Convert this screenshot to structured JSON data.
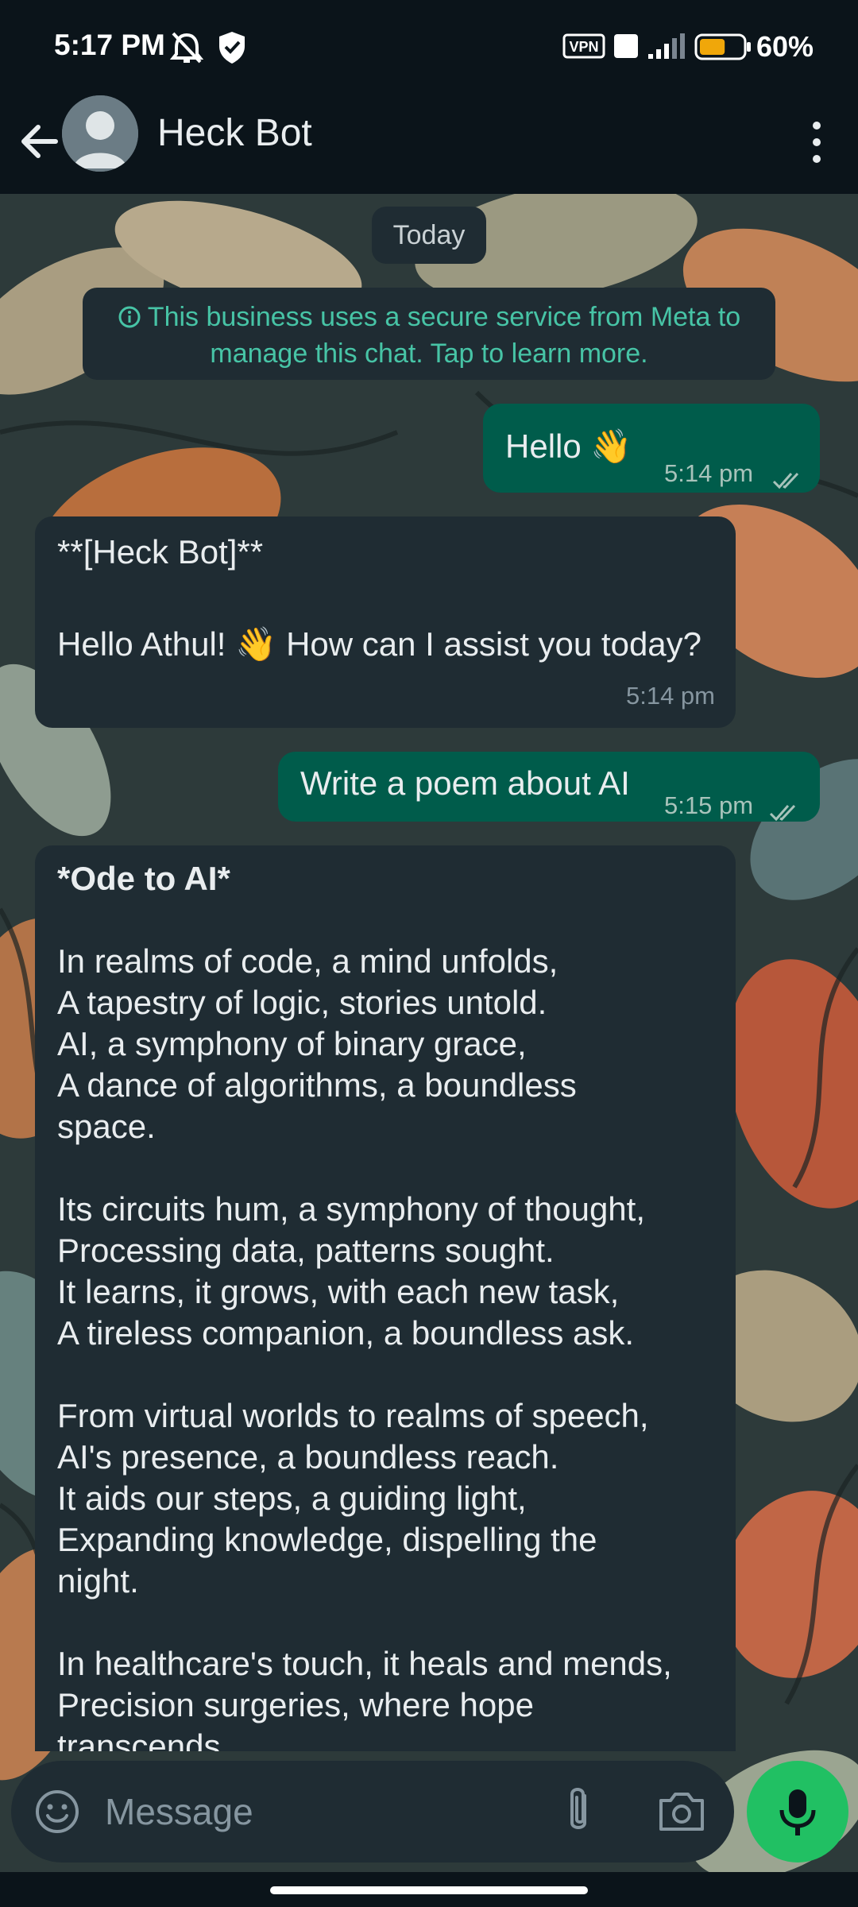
{
  "status_bar": {
    "time": "5:17 PM",
    "battery_percent": "60%",
    "battery_level": 0.6,
    "icons": [
      "alarm-off-icon",
      "shield-icon",
      "vpn-icon",
      "volte-icon",
      "signal-icon",
      "battery-icon"
    ],
    "vpn_label": "VPN"
  },
  "header": {
    "title": "Heck Bot",
    "icons": [
      "back-arrow-icon",
      "avatar",
      "more-vertical-icon"
    ]
  },
  "chat": {
    "date_chip": "Today",
    "notice": "This business uses a secure service from Meta to manage this chat. Tap to learn more.",
    "messages": [
      {
        "direction": "out",
        "text": "Hello 👋",
        "time": "5:14 pm",
        "status": "read"
      },
      {
        "direction": "in",
        "sender_line": "**[Heck Bot]**",
        "text": "Hello Athul! 👋 How can I assist you today?",
        "time": "5:14 pm"
      },
      {
        "direction": "out",
        "text": "Write a poem about AI",
        "time": "5:15 pm",
        "status": "read"
      },
      {
        "direction": "in",
        "title": "*Ode to AI*",
        "lines": [
          "In realms of code, a mind unfolds,",
          "A tapestry of logic, stories untold.",
          "AI, a symphony of binary grace,",
          "A dance of algorithms, a boundless",
          "space.",
          "",
          "Its circuits hum, a symphony of thought,",
          "Processing data, patterns sought.",
          "It learns, it grows, with each new task,",
          "A tireless companion, a boundless ask.",
          "",
          "From virtual worlds to realms of speech,",
          "AI's presence, a boundless reach.",
          "It aids our steps, a guiding light,",
          "Expanding knowledge, dispelling the",
          "night.",
          "",
          "In healthcare's touch, it heals and mends,",
          "Precision surgeries, where hope",
          "transcends"
        ]
      }
    ]
  },
  "composer": {
    "placeholder": "Message",
    "icons": [
      "emoji-icon",
      "attach-icon",
      "camera-icon",
      "mic-icon"
    ]
  },
  "colors": {
    "background": "#0b141a",
    "outgoing_bubble": "#005c4b",
    "incoming_bubble": "#1f2c33",
    "accent_green": "#21c063",
    "notice_text": "#47c4a6"
  }
}
